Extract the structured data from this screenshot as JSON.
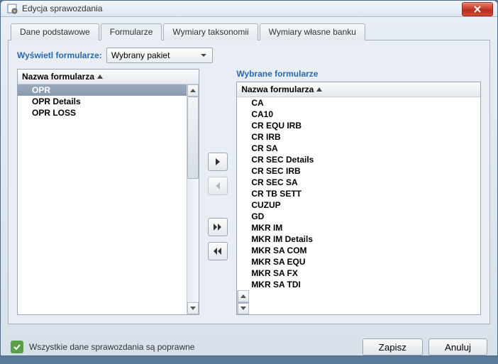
{
  "window": {
    "title": "Edycja sprawozdania"
  },
  "tabs": [
    {
      "label": "Dane podstawowe"
    },
    {
      "label": "Formularze"
    },
    {
      "label": "Wymiary taksonomii"
    },
    {
      "label": "Wymiary własne banku"
    }
  ],
  "filter": {
    "label": "Wyświetl formularze:",
    "value": "Wybrany pakiet"
  },
  "left_list": {
    "header": "Nazwa formularza",
    "items": [
      "OPR",
      "OPR Details",
      "OPR LOSS"
    ],
    "selected_index": 0
  },
  "right_list": {
    "title": "Wybrane formularze",
    "header": "Nazwa formularza",
    "items": [
      "CA",
      "CA10",
      "CR EQU IRB",
      "CR IRB",
      "CR SA",
      "CR SEC Details",
      "CR SEC IRB",
      "CR SEC SA",
      "CR TB SETT",
      "CUZUP",
      "GD",
      "MKR IM",
      "MKR IM Details",
      "MKR SA COM",
      "MKR SA EQU",
      "MKR SA FX",
      "MKR SA TDI"
    ]
  },
  "movers": {
    "add": "▶",
    "remove": "◀",
    "add_all": "▶▶",
    "remove_all": "◀◀"
  },
  "validation": {
    "label": "Wszystkie dane sprawozdania są poprawne"
  },
  "buttons": {
    "save": "Zapisz",
    "cancel": "Anuluj"
  }
}
